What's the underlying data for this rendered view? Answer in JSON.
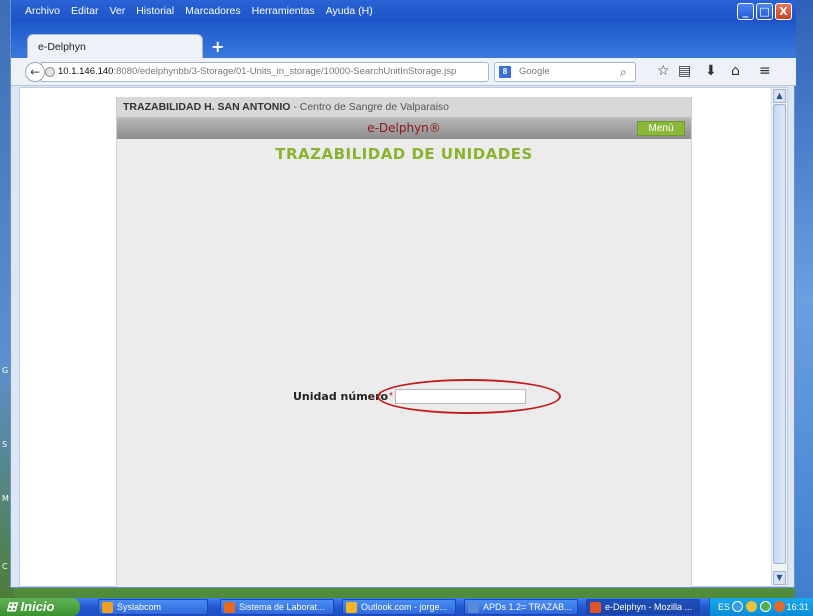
{
  "browser": {
    "menu": [
      "Archivo",
      "Editar",
      "Ver",
      "Historial",
      "Marcadores",
      "Herramientas",
      "Ayuda (H)"
    ],
    "tab_title": "e-Delphyn",
    "new_tab": "+",
    "url_host": "10.1.146.140",
    "url_rest": ":8080/edelphynbb/3-Storage/01-Units_in_storage/10000-SearchUnitInStorage.jsp",
    "search_placeholder": "Google",
    "window_controls": [
      "_",
      "□",
      "X"
    ]
  },
  "app": {
    "header_bold": "TRAZABILIDAD H. SAN ANTONIO",
    "header_rest": " - Centro de Sangre de Valparaiso",
    "brand": "e-Delphyn®",
    "menu_button": "Menú",
    "page_title": "TRAZABILIDAD DE UNIDADES",
    "unit_label": "Unidad número",
    "unit_required": "*",
    "unit_value": ""
  },
  "taskbar": {
    "start": "Inicio",
    "tasks": [
      {
        "label": "Syslabcom",
        "color": "#f0a020"
      },
      {
        "label": "Sistema de Laborat...",
        "color": "#e26b1f"
      },
      {
        "label": "Outlook.com - jorge...",
        "color": "#f5b52a"
      },
      {
        "label": "APDs 1.2= TRAZAB...",
        "color": "#5a8ad6"
      },
      {
        "label": "e-Delphyn - Mozilla ...",
        "color": "#e0542a"
      }
    ],
    "language": "ES",
    "clock": "16:31"
  },
  "desktop": {
    "left_labels": [
      "G",
      "S",
      "M",
      "C"
    ]
  }
}
